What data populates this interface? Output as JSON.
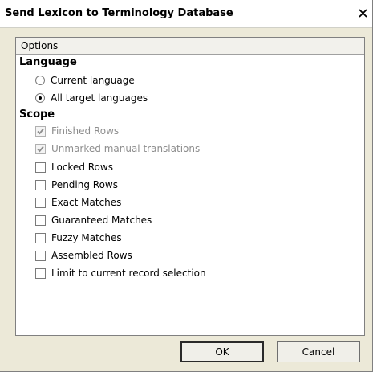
{
  "window": {
    "title": "Send Lexicon to Terminology Database",
    "close_icon": "close-icon"
  },
  "panel": {
    "tab_label": "Options"
  },
  "language": {
    "heading": "Language",
    "options": [
      {
        "label": "Current language",
        "checked": false
      },
      {
        "label": "All target languages",
        "checked": true
      }
    ]
  },
  "scope": {
    "heading": "Scope",
    "items": [
      {
        "label": "Finished Rows",
        "checked": true,
        "disabled": true
      },
      {
        "label": "Unmarked manual translations",
        "checked": true,
        "disabled": true
      },
      {
        "label": "Locked Rows",
        "checked": false,
        "disabled": false
      },
      {
        "label": "Pending Rows",
        "checked": false,
        "disabled": false
      },
      {
        "label": "Exact Matches",
        "checked": false,
        "disabled": false
      },
      {
        "label": "Guaranteed Matches",
        "checked": false,
        "disabled": false
      },
      {
        "label": "Fuzzy Matches",
        "checked": false,
        "disabled": false
      },
      {
        "label": "Assembled Rows",
        "checked": false,
        "disabled": false
      },
      {
        "label": "Limit to current record selection",
        "checked": false,
        "disabled": false
      }
    ]
  },
  "buttons": {
    "ok_label": "OK",
    "cancel_label": "Cancel"
  },
  "colors": {
    "dialog_background": "#ece9d8",
    "disabled_text": "#8d8d8d",
    "checkmark_disabled": "#8d8d8d"
  }
}
